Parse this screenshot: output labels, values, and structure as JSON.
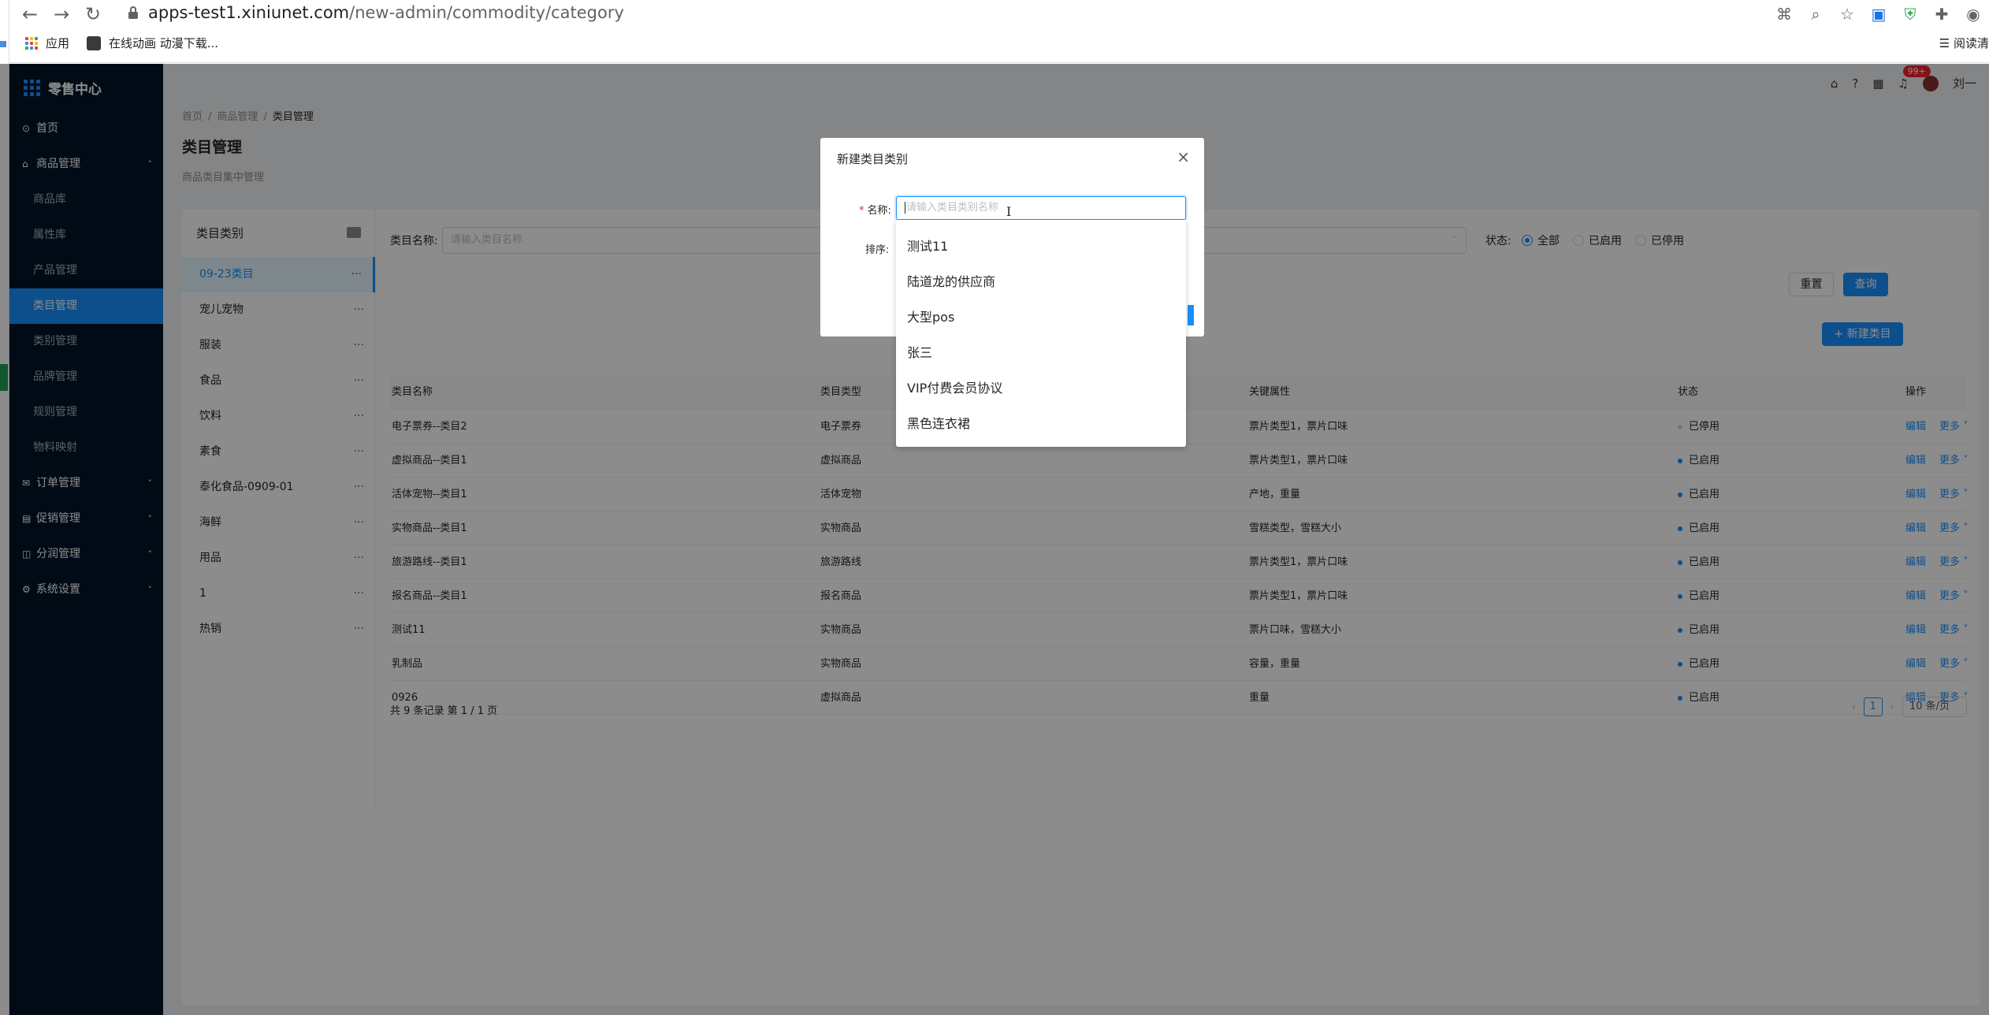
{
  "browser": {
    "url_host": "apps-test1.xiniunet.com",
    "url_path": "/new-admin/commodity/category",
    "bookmarks": [
      {
        "label": "应用",
        "icon": "apps-grid-icon"
      },
      {
        "label": "在线动画 动漫下载...",
        "icon": "site-favicon-icon"
      }
    ],
    "reading_list": "阅读清"
  },
  "sidebar": {
    "brand": "零售中心",
    "menu": [
      {
        "label": "首页",
        "level": "top",
        "icon": "home-icon"
      },
      {
        "label": "商品管理",
        "level": "top",
        "icon": "shop-icon",
        "arrow": "˄"
      },
      {
        "label": "商品库",
        "level": "sub"
      },
      {
        "label": "属性库",
        "level": "sub"
      },
      {
        "label": "产品管理",
        "level": "sub"
      },
      {
        "label": "类目管理",
        "level": "sub",
        "active": true
      },
      {
        "label": "类别管理",
        "level": "sub"
      },
      {
        "label": "品牌管理",
        "level": "sub"
      },
      {
        "label": "规则管理",
        "level": "sub"
      },
      {
        "label": "物料映射",
        "level": "sub"
      },
      {
        "label": "订单管理",
        "level": "top",
        "icon": "mail-icon",
        "arrow": "˅"
      },
      {
        "label": "促销管理",
        "level": "top",
        "icon": "calendar-icon",
        "arrow": "˅"
      },
      {
        "label": "分润管理",
        "level": "top",
        "icon": "share-icon",
        "arrow": "˅"
      },
      {
        "label": "系统设置",
        "level": "top",
        "icon": "settings-icon",
        "arrow": "˅"
      }
    ]
  },
  "header": {
    "badge": "99+",
    "user": "刘一"
  },
  "breadcrumb": [
    "首页",
    "商品管理",
    "类目管理"
  ],
  "page": {
    "title": "类目管理",
    "description": "商品类目集中管理"
  },
  "category_panel": {
    "title": "类目类别",
    "items": [
      "09-23类目",
      "宠儿宠物",
      "服装",
      "食品",
      "饮料",
      "素食",
      "泰化食品-0909-01",
      "海鲜",
      "用品",
      "1",
      "热销"
    ]
  },
  "filter": {
    "name_label": "类目名称:",
    "name_placeholder": "请输入类目名称",
    "status_label": "状态:",
    "status_options": [
      "全部",
      "已启用",
      "已停用"
    ],
    "reset": "重置",
    "query": "查询",
    "new_button": "+ 新建类目"
  },
  "table": {
    "headers": [
      "类目名称",
      "类目类型",
      "关键属性",
      "状态",
      "操作"
    ],
    "rows": [
      {
        "name": "电子票券--类目2",
        "type": "电子票券",
        "attrs": "票片类型1，票片口味",
        "status": "已停用",
        "enabled": false
      },
      {
        "name": "虚拟商品--类目1",
        "type": "虚拟商品",
        "attrs": "票片类型1，票片口味",
        "status": "已启用",
        "enabled": true
      },
      {
        "name": "活体宠物--类目1",
        "type": "活体宠物",
        "attrs": "产地，重量",
        "status": "已启用",
        "enabled": true
      },
      {
        "name": "实物商品--类目1",
        "type": "实物商品",
        "attrs": "雪糕类型，雪糕大小",
        "status": "已启用",
        "enabled": true
      },
      {
        "name": "旅游路线--类目1",
        "type": "旅游路线",
        "attrs": "票片类型1，票片口味",
        "status": "已启用",
        "enabled": true
      },
      {
        "name": "报名商品--类目1",
        "type": "报名商品",
        "attrs": "票片类型1，票片口味",
        "status": "已启用",
        "enabled": true
      },
      {
        "name": "测试11",
        "type": "实物商品",
        "attrs": "票片口味，雪糕大小",
        "status": "已启用",
        "enabled": true
      },
      {
        "name": "乳制品",
        "type": "实物商品",
        "attrs": "容量，重量",
        "status": "已启用",
        "enabled": true
      },
      {
        "name": "0926",
        "type": "虚拟商品",
        "attrs": "重量",
        "status": "已启用",
        "enabled": true
      }
    ],
    "edit": "编辑",
    "more": "更多 ˅"
  },
  "pagination": {
    "total": "共 9 条记录 第 1 / 1 页",
    "current": "1",
    "page_size": "10 条/页"
  },
  "modal": {
    "title": "新建类目类别",
    "name_label": "名称:",
    "name_placeholder": "请输入类目类别名称",
    "sort_label": "排序:",
    "suggestions": [
      "测试11",
      "陆道龙的供应商",
      "大型pos",
      "张三",
      "VIP付费会员协议",
      "黑色连衣裙"
    ]
  },
  "colors": {
    "sidebar": "#001529",
    "primary": "#1890ff",
    "mask": "rgba(0,0,0,0.45)"
  }
}
